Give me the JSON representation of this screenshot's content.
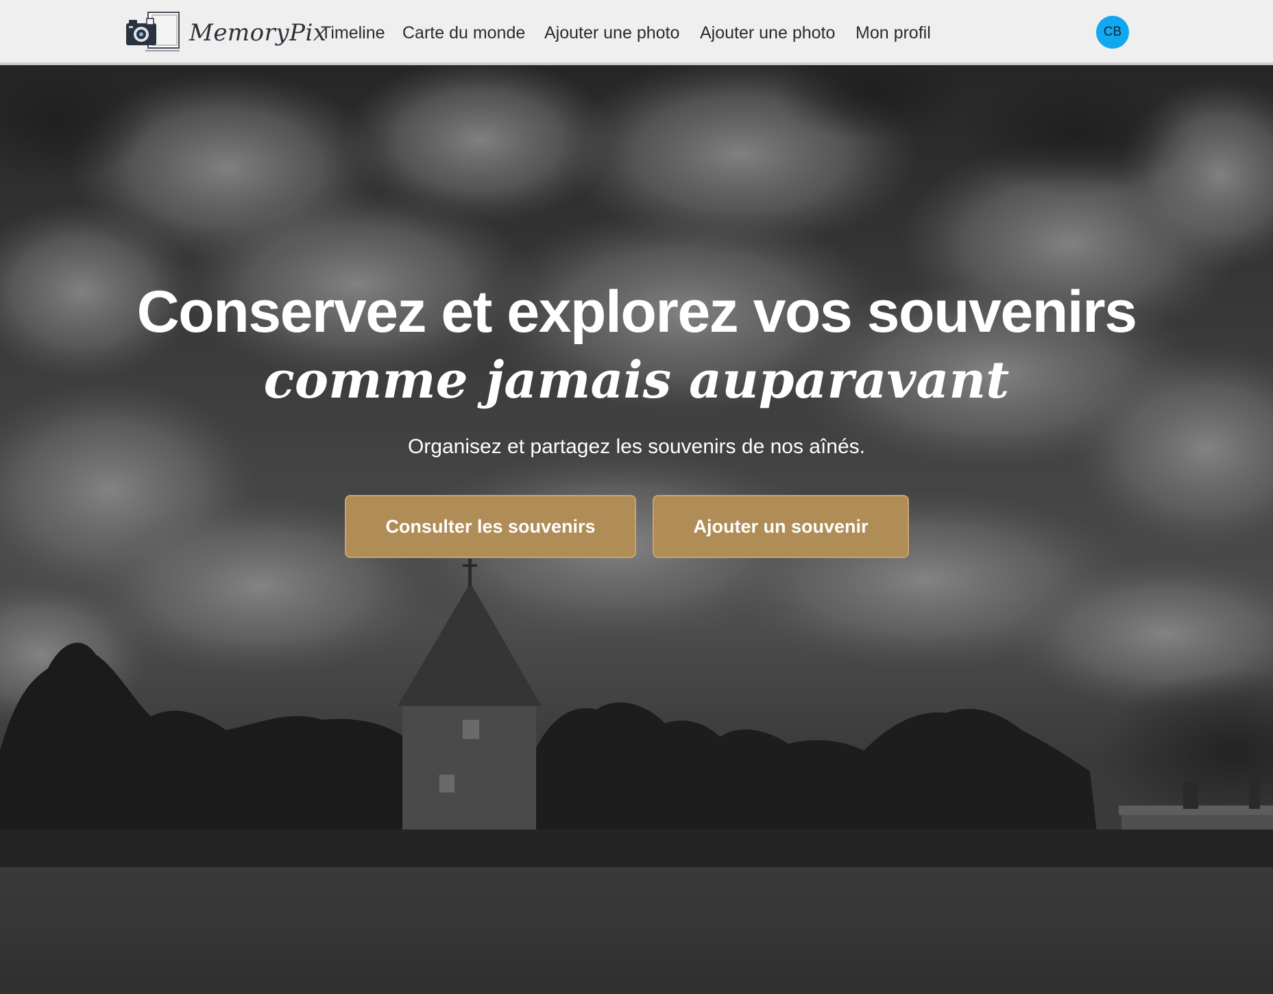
{
  "header": {
    "brand": "MemoryPix",
    "logo_icon": "camera-photo-logo-icon",
    "nav": [
      {
        "label": "Timeline"
      },
      {
        "label": "Carte du monde"
      },
      {
        "label": "Ajouter une photo"
      },
      {
        "label": "Ajouter une photo"
      },
      {
        "label": "Mon profil"
      }
    ],
    "avatar_initials": "CB",
    "avatar_color": "#12a8ef"
  },
  "hero": {
    "title": "Conservez et explorez vos souvenirs",
    "title_italic": "comme jamais auparavant",
    "subtitle": "Organisez et partagez les souvenirs de nos aînés.",
    "buttons": [
      {
        "label": "Consulter les souvenirs"
      },
      {
        "label": "Ajouter un souvenir"
      }
    ],
    "button_color": "#b08d57",
    "background": "black-and-white photo of cloudy sky over a round stone tower, trees and meadow"
  }
}
